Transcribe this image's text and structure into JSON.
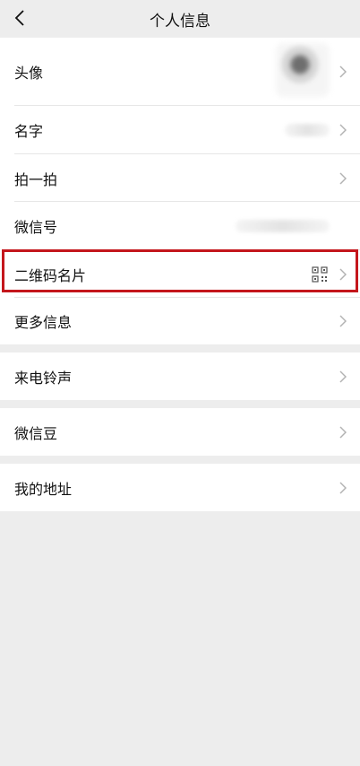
{
  "nav": {
    "title": "个人信息",
    "back_icon": "chevron-left-icon"
  },
  "rows": {
    "avatar": {
      "label": "头像"
    },
    "name": {
      "label": "名字"
    },
    "pat": {
      "label": "拍一拍"
    },
    "wechat_id": {
      "label": "微信号"
    },
    "qr_card": {
      "label": "二维码名片",
      "icon": "qr-code-icon"
    },
    "more_info": {
      "label": "更多信息"
    },
    "ringtone": {
      "label": "来电铃声"
    },
    "beans": {
      "label": "微信豆"
    },
    "address": {
      "label": "我的地址"
    }
  },
  "colors": {
    "background": "#ededed",
    "row_background": "#ffffff",
    "highlight": "#c4161c",
    "chevron": "#b2b2b2"
  }
}
